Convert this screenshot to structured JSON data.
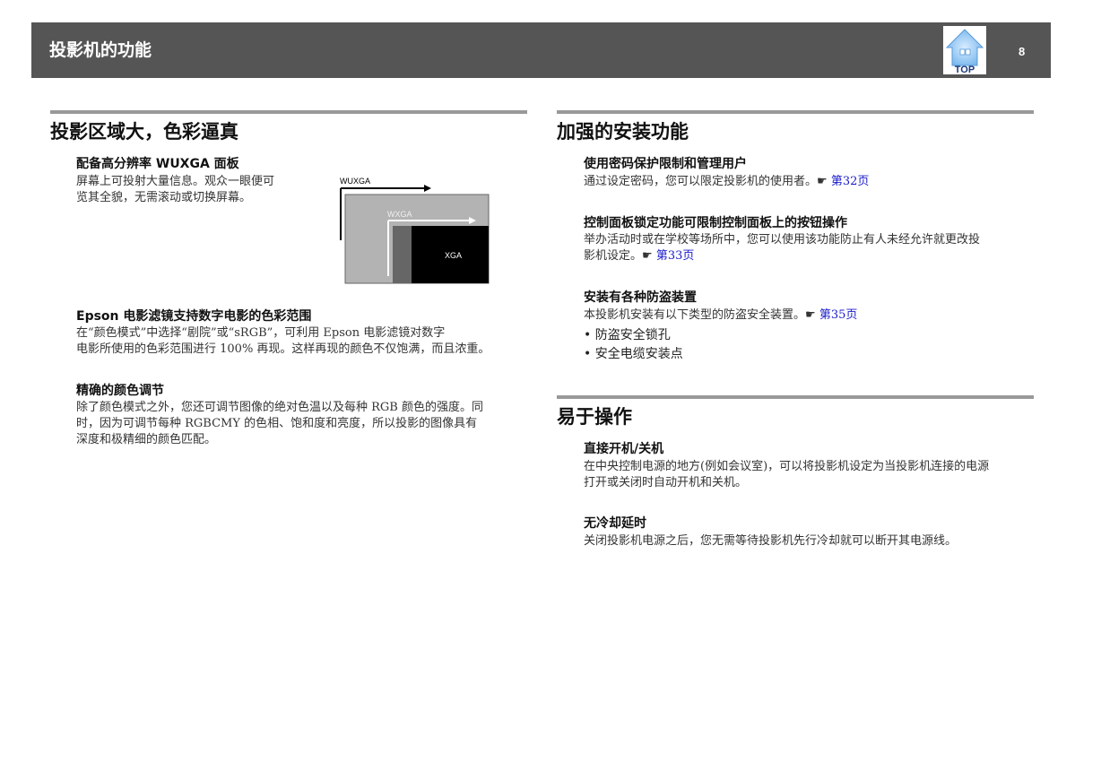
{
  "header": {
    "title": "投影机的功能",
    "page_number": "8",
    "top_label": "TOP"
  },
  "left": {
    "section1": {
      "title": "投影区域大，色彩逼真",
      "sub1": {
        "title": "配备高分辨率 WUXGA 面板",
        "body_line1": "屏幕上可投射大量信息。观众一眼便可",
        "body_line2": "览其全貌，无需滚动或切换屏幕。"
      },
      "figure": {
        "label_wuxga": "WUXGA",
        "label_wxga": "WXGA",
        "label_xga": "XGA"
      },
      "sub2": {
        "title": "Epson 电影滤镜支持数字电影的色彩范围",
        "body_line1": "在“颜色模式”中选择“剧院”或“sRGB”，可利用 Epson 电影滤镜对数字",
        "body_line2": "电影所使用的色彩范围进行 100% 再现。这样再现的颜色不仅饱满，而且浓重。"
      },
      "sub3": {
        "title": "精确的颜色调节",
        "body_line1": "除了颜色模式之外，您还可调节图像的绝对色温以及每种 RGB 颜色的强度。同",
        "body_line2": "时，因为可调节每种 RGBCMY 的色相、饱和度和亮度，所以投影的图像具有",
        "body_line3": "深度和极精细的颜色匹配。"
      }
    }
  },
  "right": {
    "section2": {
      "title": "加强的安装功能",
      "sub1": {
        "title": "使用密码保护限制和管理用户",
        "body": "通过设定密码，您可以限定投影机的使用者。",
        "ref_icon": "☛",
        "link": "第32页"
      },
      "sub2": {
        "title": "控制面板锁定功能可限制控制面板上的按钮操作",
        "body_line1": "举办活动时或在学校等场所中，您可以使用该功能防止有人未经允许就更改投",
        "body_line2": "影机设定。",
        "ref_icon": "☛",
        "link": "第33页"
      },
      "sub3": {
        "title": "安装有各种防盗装置",
        "body": "本投影机安装有以下类型的防盗安全装置。",
        "ref_icon": "☛",
        "link": "第35页",
        "bullets": [
          "防盗安全锁孔",
          "安全电缆安装点"
        ]
      }
    },
    "section3": {
      "title": "易于操作",
      "sub1": {
        "title": "直接开机/关机",
        "body_line1": "在中央控制电源的地方(例如会议室)，可以将投影机设定为当投影机连接的电源",
        "body_line2": "打开或关闭时自动开机和关机。"
      },
      "sub2": {
        "title": "无冷却延时",
        "body": "关闭投影机电源之后，您无需等待投影机先行冷却就可以断开其电源线。"
      }
    }
  },
  "colors": {
    "header_bg": "#555555",
    "section_bar": "#999999",
    "link": "#1a1acc"
  }
}
